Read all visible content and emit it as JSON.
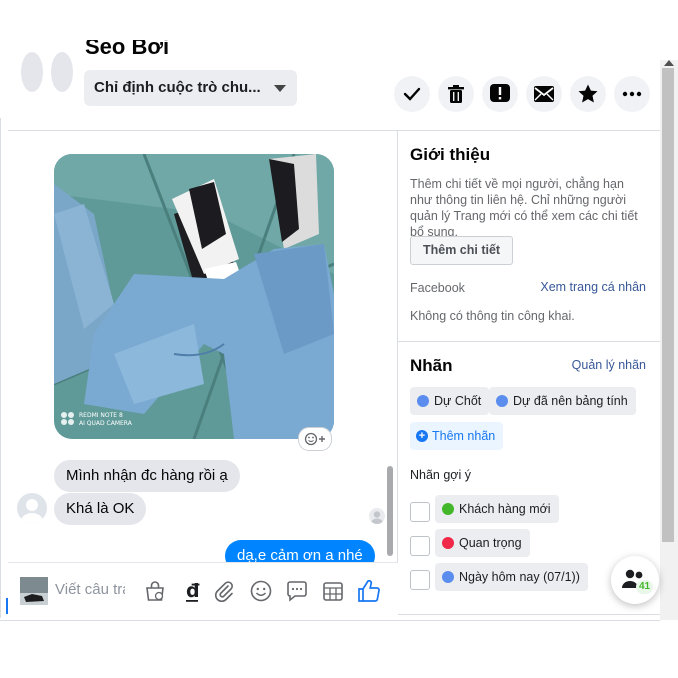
{
  "header": {
    "name": "Sẹo Bơi",
    "assign_label": "Chỉ định cuộc trò chu...",
    "actions": [
      "check-icon",
      "trash-icon",
      "report-icon",
      "mail-icon",
      "star-icon",
      "more-icon"
    ]
  },
  "chat": {
    "photo_watermark_line1": "REDMI NOTE 8",
    "photo_watermark_line2": "AI QUAD CAMERA",
    "messages_in": [
      "Mình nhận đc hàng rồi ạ",
      "Khá là OK"
    ],
    "message_out": "dạ,e cảm ơn a nhé"
  },
  "composer": {
    "placeholder": "Viết câu trả",
    "icons": [
      "shop-bag-icon",
      "currency-icon",
      "attach-icon",
      "emoji-icon",
      "saved-reply-icon",
      "appointment-icon",
      "like-icon"
    ]
  },
  "panel": {
    "intro": {
      "heading": "Giới thiệu",
      "desc": "Thêm chi tiết về mọi người, chẳng hạn như thông tin liên hệ. Chỉ những người quản lý Trang mới có thể xem các chi tiết bổ sung.",
      "add_details_button": "Thêm chi tiết",
      "facebook_label": "Facebook",
      "view_profile_link": "Xem trang cá nhân",
      "no_public_info": "Không có thông tin công khai."
    },
    "labels": {
      "heading": "Nhãn",
      "manage_link": "Quản lý nhãn",
      "tags": [
        {
          "label": "Dự Chốt",
          "color": "#5b8def"
        },
        {
          "label": "Dự đã nên bảng tính",
          "color": "#5b8def"
        }
      ],
      "add_tag_button": "Thêm nhãn",
      "suggested_heading": "Nhãn gợi ý",
      "suggested": [
        {
          "label": "Khách hàng mới",
          "color": "#42b72a"
        },
        {
          "label": "Quan trọng",
          "color": "#f02849"
        },
        {
          "label": "Ngày hôm nay (07/1))",
          "color": "#5b8def"
        }
      ]
    }
  },
  "fab": {
    "badge": "41"
  }
}
